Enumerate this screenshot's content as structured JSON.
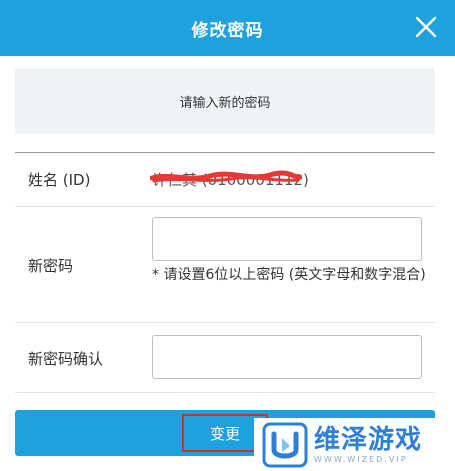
{
  "header": {
    "title": "修改密码",
    "close_icon": "close-icon"
  },
  "notice": "请输入新的密码",
  "form": {
    "id_label": "姓名 (ID)",
    "id_value": "许仁其 (0100001112)",
    "new_password_label": "新密码",
    "new_password_value": "",
    "hint": "* 请设置6位以上密码 (英文字母和数字混合)",
    "confirm_label": "新密码确认",
    "confirm_value": ""
  },
  "submit_label": "变更",
  "watermark": {
    "title": "维泽游戏",
    "subtitle": "WWW.WIZED.VIP"
  },
  "colors": {
    "accent": "#1ea1dc",
    "highlight_box": "#c0392b",
    "redaction": "#e53935"
  }
}
